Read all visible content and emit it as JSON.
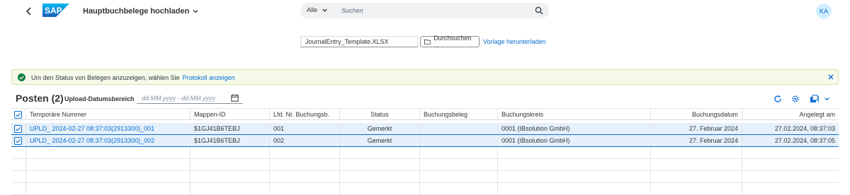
{
  "shell": {
    "title": "Hauptbuchbelege hochladen",
    "search_scope": "Alle",
    "search_placeholder": "Suchen",
    "avatar_initials": "KA"
  },
  "upload": {
    "file_name": "JournalEntry_Template.XLSX",
    "browse_label": "Durchsuchen ...",
    "download_link": "Vorlage herunterladen"
  },
  "message_strip": {
    "text": "Um den Status von Belegen anzuzeigen, wählen Sie",
    "link": "Protokoll anzeigen"
  },
  "table": {
    "title": "Posten (2)",
    "range_label": "Upload-Datumsbereich",
    "range_placeholder": "dd.MM.yyyy - dd.MM.yyyy",
    "columns": [
      "Temporäre Nummer",
      "Mappen-ID",
      "Lfd. Nr. Buchungsb.",
      "Status",
      "Buchungsbeleg",
      "Buchungskreis",
      "Buchungsdatum",
      "Angelegt am"
    ],
    "rows": [
      [
        "UPLD_ 2024-02-27 08:37:03(2913300)_001",
        "$1GJ41B6TEBJ",
        "001",
        "Gemerkt",
        "",
        "0001 (IBsolution GmbH)",
        "27. Februar 2024",
        "27.02.2024, 08:37:03"
      ],
      [
        "UPLD_ 2024-02-27 08:37:03(2913300)_002",
        "$1GJ41B6TEBJ",
        "002",
        "Gemerkt",
        "",
        "0001 (IBsolution GmbH)",
        "27. Februar 2024",
        "27.02.2024, 08:37:05"
      ]
    ]
  },
  "colors": {
    "accent": "#0a6ed1",
    "success": "#107e3e",
    "selected_row": "#e5f0fa"
  }
}
